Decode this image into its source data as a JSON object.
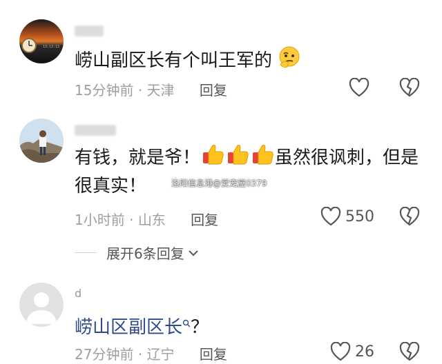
{
  "comments": [
    {
      "username": "",
      "text": "崂山副区长有个叫王军的",
      "time": "15分钟前",
      "location": "天津",
      "reply_label": "回复",
      "like_count": "",
      "emoji": "thinking-face-icon"
    },
    {
      "username": "",
      "text_part1": "有钱，就是爷！",
      "text_part2": "虽然很讽刺，但是",
      "text_line2": "很真实！",
      "time": "1小时前",
      "location": "山东",
      "reply_label": "回复",
      "like_count": "550",
      "emoji": "thumbs-up-icon"
    },
    {
      "username_initial": "d",
      "text": "崂山区副区长",
      "text_suffix": "？",
      "time": "27分钟前",
      "location": "辽宁",
      "reply_label": "回复",
      "like_count": "26"
    }
  ],
  "expand_replies": "展开6条回复",
  "meta_separator": "·",
  "watermark": "洛阳信息港@爱宠屋0379",
  "clock_digits": "13:13:13",
  "colors": {
    "link": "#2e4a8a",
    "muted": "#9e9e9e",
    "thumb": "#f5a623"
  }
}
